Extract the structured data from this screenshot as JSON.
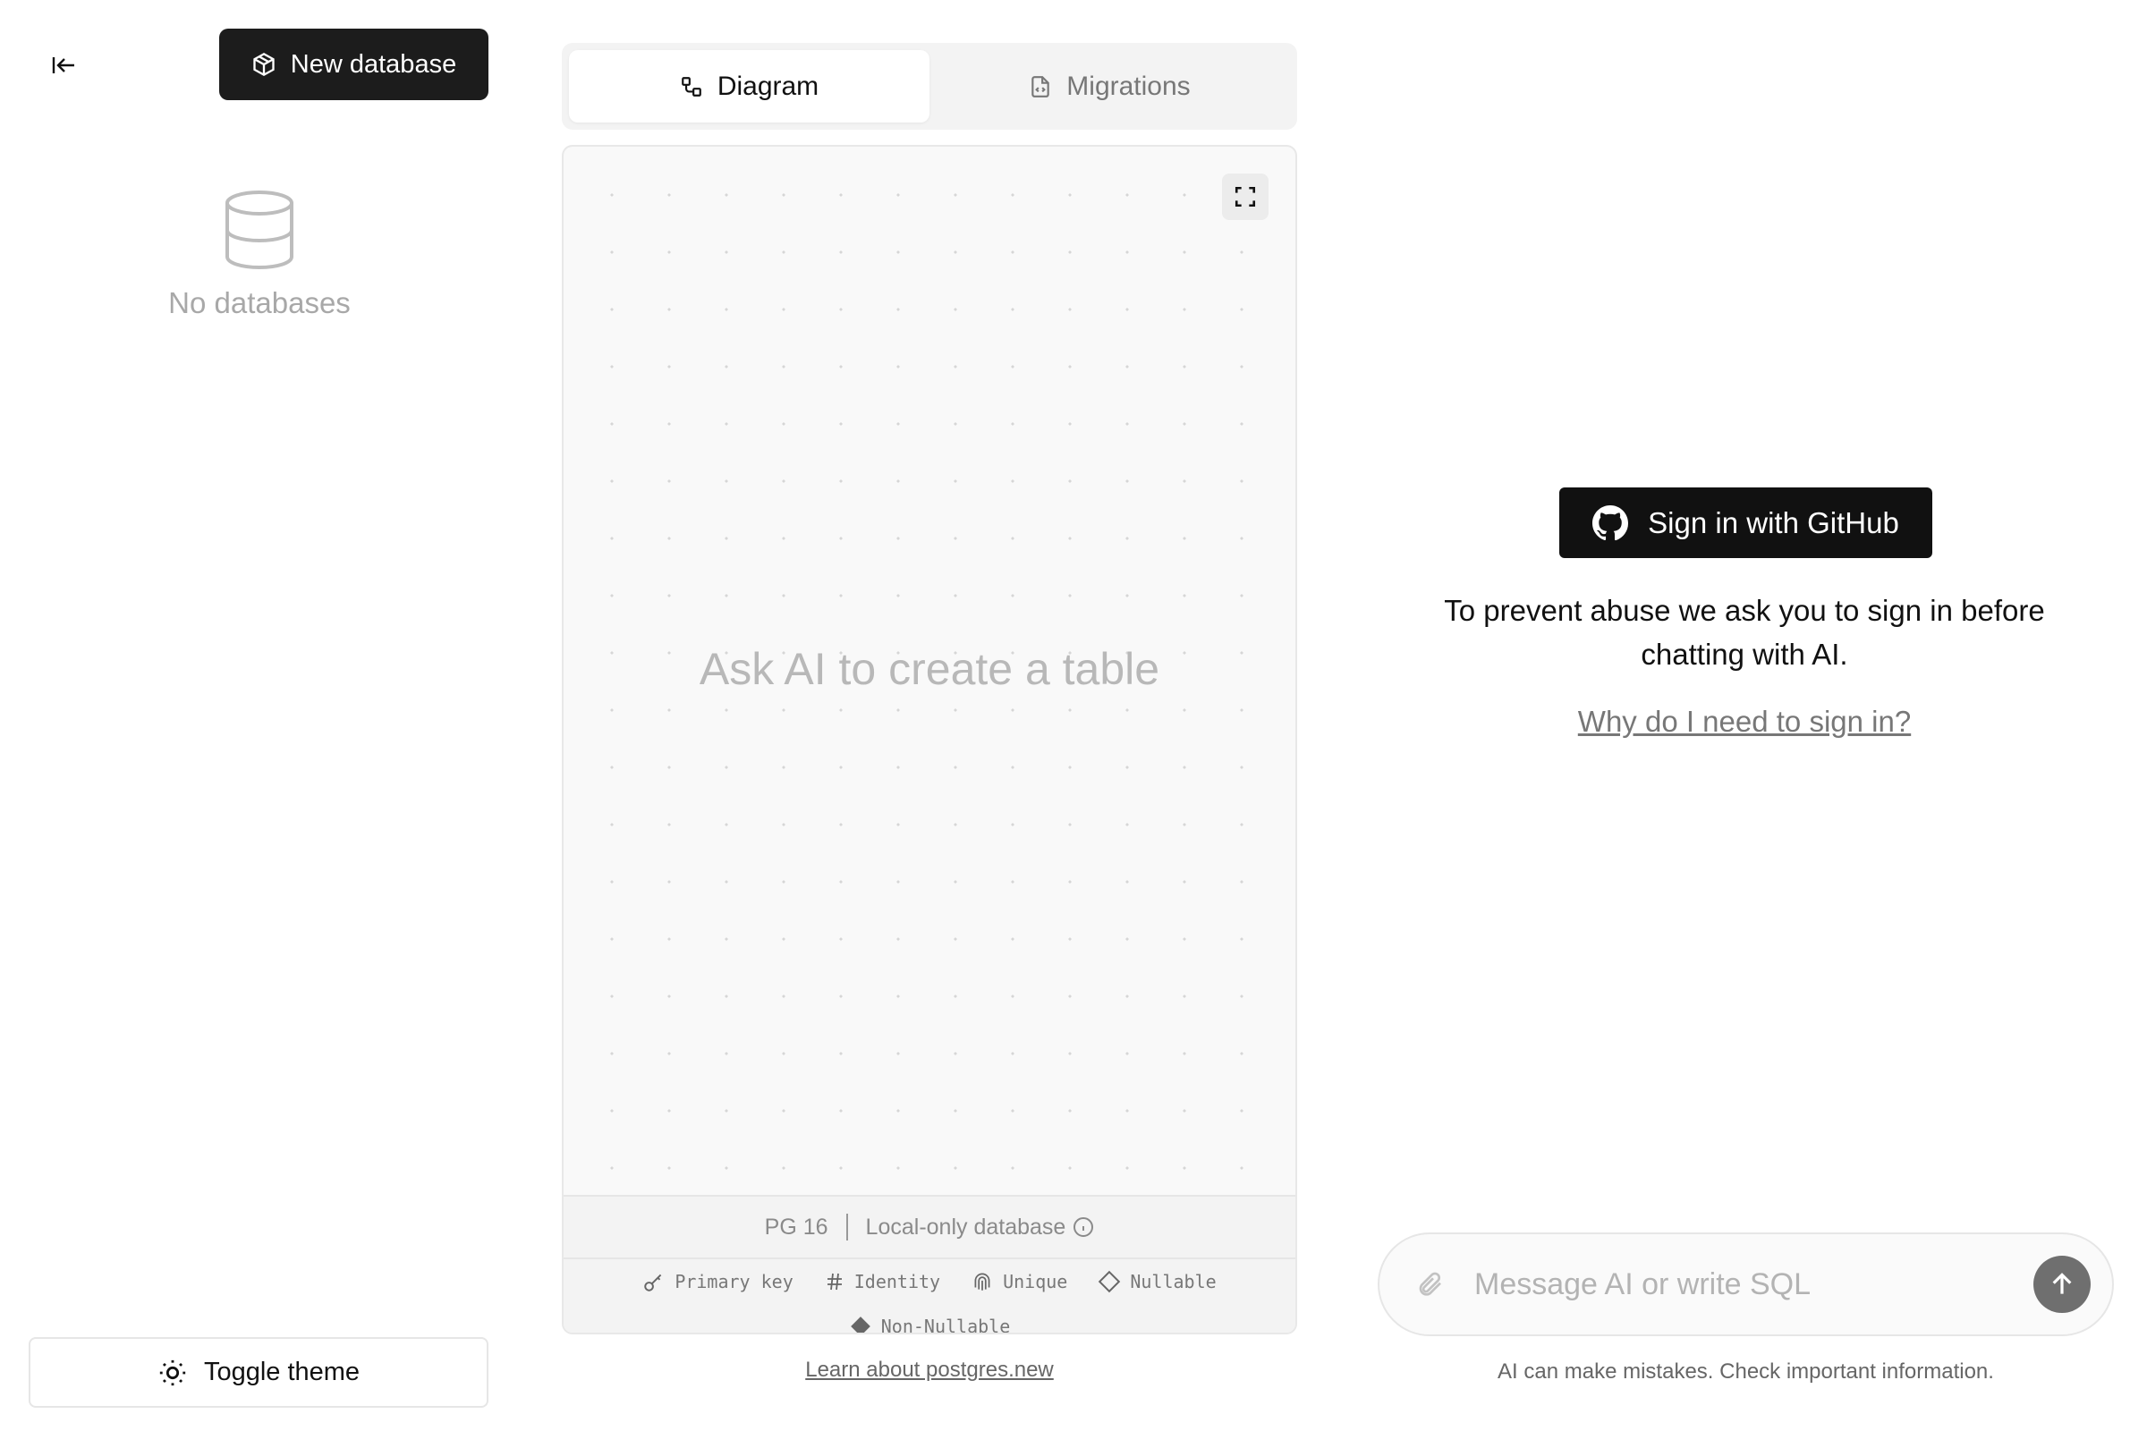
{
  "sidebar": {
    "new_database_label": "New database",
    "empty_text": "No databases",
    "toggle_theme_label": "Toggle theme"
  },
  "tabs": [
    {
      "label": "Diagram",
      "active": true
    },
    {
      "label": "Migrations",
      "active": false
    }
  ],
  "diagram": {
    "placeholder": "Ask AI to create a table",
    "pg_version": "PG 16",
    "db_mode": "Local-only database",
    "legend": [
      "Primary key",
      "Identity",
      "Unique",
      "Nullable",
      "Non-Nullable"
    ]
  },
  "learn_link": "Learn about postgres.new",
  "auth": {
    "signin_label": "Sign in with GitHub",
    "message": "To prevent abuse we ask you to sign in before chatting with AI.",
    "why_link": "Why do I need to sign in?"
  },
  "chat": {
    "placeholder": "Message AI or write SQL",
    "value": "",
    "disclaimer": "AI can make mistakes. Check important information."
  }
}
